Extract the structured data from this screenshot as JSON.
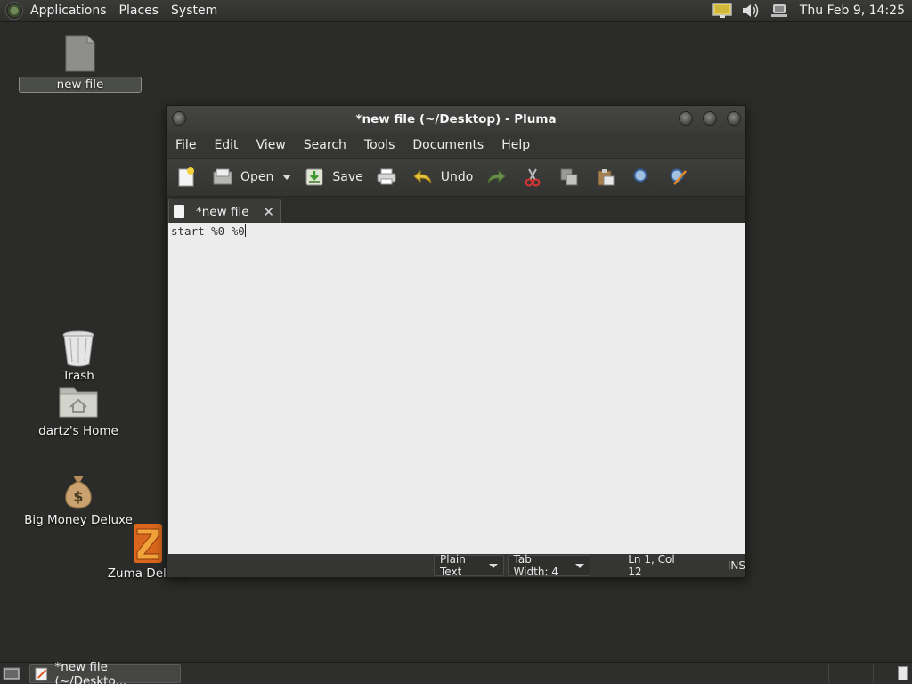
{
  "top_panel": {
    "menus": [
      "Applications",
      "Places",
      "System"
    ],
    "clock": "Thu Feb  9, 14:25",
    "tray_icons": [
      "display-icon",
      "volume-icon",
      "network-icon"
    ]
  },
  "desktop": {
    "icons": [
      {
        "label": "new file",
        "icon": "file-icon",
        "selected": true
      },
      {
        "label": "Trash",
        "icon": "trash-icon"
      },
      {
        "label": "dartz's Home",
        "icon": "home-folder-icon"
      },
      {
        "label": "Big Money Deluxe",
        "icon": "money-bag-icon"
      },
      {
        "label": "Zuma Deluxe",
        "icon": "zuma-icon"
      }
    ]
  },
  "window": {
    "title": "*new file (~/Desktop) - Pluma",
    "menu": [
      "File",
      "Edit",
      "View",
      "Search",
      "Tools",
      "Documents",
      "Help"
    ],
    "toolbar": {
      "new_icon": "new-document-icon",
      "open_label": "Open",
      "save_label": "Save",
      "undo_label": "Undo"
    },
    "tab": {
      "label": "*new file"
    },
    "editor": {
      "content": "start %0 %0"
    },
    "status": {
      "language": "Plain Text",
      "tab_width": "Tab Width:  4",
      "position": "Ln 1, Col 12",
      "mode": "INS"
    }
  },
  "bottom_panel": {
    "task_label": "*new file (~/Deskto..."
  }
}
